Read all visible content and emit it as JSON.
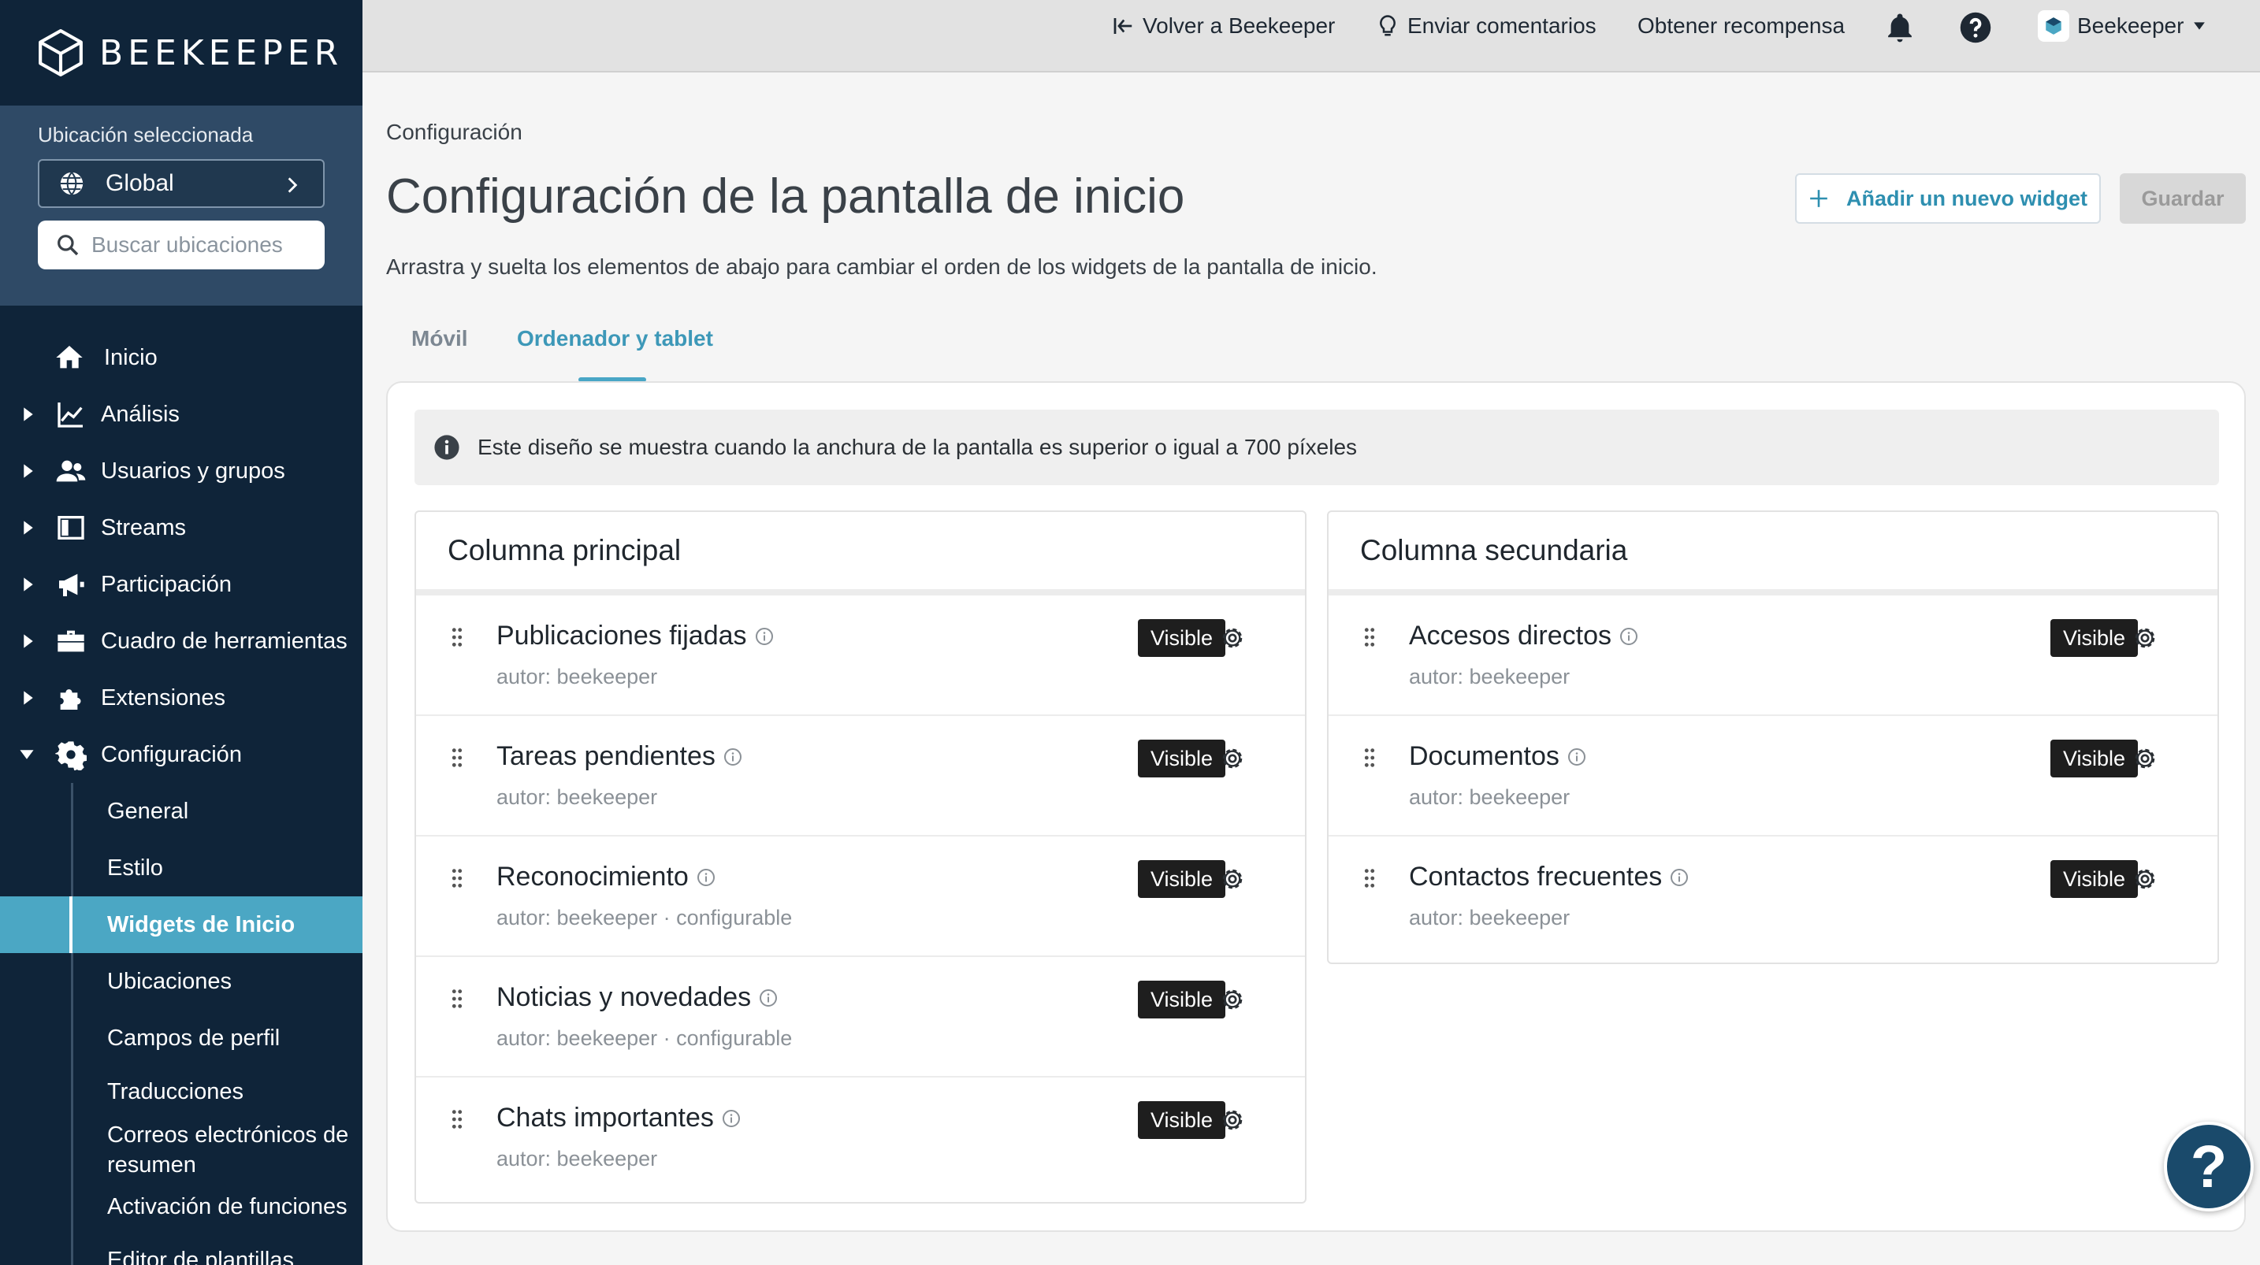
{
  "brand": {
    "name": "BEEKEEPER"
  },
  "location": {
    "label": "Ubicación seleccionada",
    "selected": "Global",
    "search_placeholder": "Buscar ubicaciones"
  },
  "nav": {
    "items": [
      {
        "label": "Inicio",
        "icon": "home-icon"
      },
      {
        "label": "Análisis",
        "icon": "chart-icon"
      },
      {
        "label": "Usuarios y grupos",
        "icon": "users-icon"
      },
      {
        "label": "Streams",
        "icon": "streams-icon"
      },
      {
        "label": "Participación",
        "icon": "megaphone-icon"
      },
      {
        "label": "Cuadro de herramientas",
        "icon": "toolbox-icon"
      },
      {
        "label": "Extensiones",
        "icon": "puzzle-icon"
      },
      {
        "label": "Configuración",
        "icon": "gear-icon"
      }
    ],
    "sub_items": [
      "General",
      "Estilo",
      "Widgets de Inicio",
      "Ubicaciones",
      "Campos de perfil",
      "Traducciones",
      "Correos electrónicos de resumen",
      "Activación de funciones",
      "Editor de plantillas"
    ]
  },
  "topbar": {
    "back": "Volver a Beekeeper",
    "feedback": "Enviar comentarios",
    "reward": "Obtener recompensa",
    "account": "Beekeeper"
  },
  "page": {
    "breadcrumb": "Configuración",
    "title": "Configuración de la pantalla de inicio",
    "subtitle": "Arrastra y suelta los elementos de abajo para cambiar el orden de los widgets de la pantalla de inicio.",
    "add_widget": "Añadir un nuevo widget",
    "save": "Guardar",
    "tabs": [
      "Móvil",
      "Ordenador y tablet"
    ],
    "active_tab": "Ordenador y tablet",
    "info": "Este diseño se muestra cuando la anchura de la pantalla es superior o igual a 700 píxeles"
  },
  "columns": {
    "main": {
      "title": "Columna principal",
      "widgets": [
        {
          "title": "Publicaciones fijadas",
          "meta": "autor: beekeeper",
          "status": "Visible"
        },
        {
          "title": "Tareas pendientes",
          "meta": "autor: beekeeper",
          "status": "Visible"
        },
        {
          "title": "Reconocimiento",
          "meta": "autor: beekeeper · configurable",
          "status": "Visible"
        },
        {
          "title": "Noticias y novedades",
          "meta": "autor: beekeeper · configurable",
          "status": "Visible"
        },
        {
          "title": "Chats importantes",
          "meta": "autor: beekeeper",
          "status": "Visible"
        }
      ]
    },
    "secondary": {
      "title": "Columna secundaria",
      "widgets": [
        {
          "title": "Accesos directos",
          "meta": "autor: beekeeper",
          "status": "Visible"
        },
        {
          "title": "Documentos",
          "meta": "autor: beekeeper",
          "status": "Visible"
        },
        {
          "title": "Contactos frecuentes",
          "meta": "autor: beekeeper",
          "status": "Visible"
        }
      ]
    }
  },
  "colors": {
    "sidebar": "#0f2439",
    "location_panel": "#2f4a66",
    "active_nav": "#4ba7c4",
    "accent": "#2e8fb0",
    "help_fab": "#1a4a6b"
  },
  "help": {
    "label": "?"
  }
}
